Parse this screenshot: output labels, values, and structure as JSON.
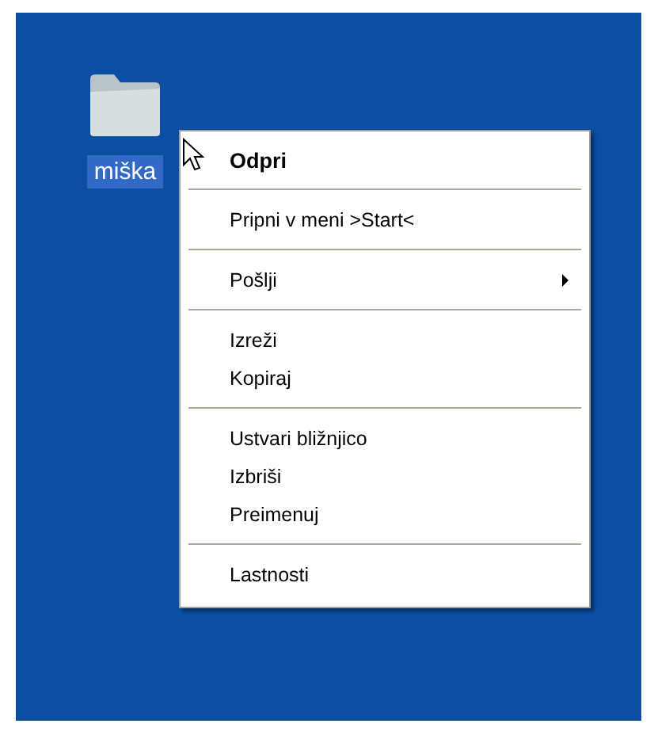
{
  "desktop_icon": {
    "label": "miška",
    "selected": true
  },
  "context_menu": {
    "groups": [
      [
        {
          "label": "Odpri",
          "default": true,
          "submenu": false
        }
      ],
      [
        {
          "label": "Pripni v meni >Start<",
          "default": false,
          "submenu": false
        }
      ],
      [
        {
          "label": "Pošlji",
          "default": false,
          "submenu": true
        }
      ],
      [
        {
          "label": "Izreži",
          "default": false,
          "submenu": false
        },
        {
          "label": "Kopiraj",
          "default": false,
          "submenu": false
        }
      ],
      [
        {
          "label": "Ustvari bližnjico",
          "default": false,
          "submenu": false
        },
        {
          "label": "Izbriši",
          "default": false,
          "submenu": false
        },
        {
          "label": "Preimenuj",
          "default": false,
          "submenu": false
        }
      ],
      [
        {
          "label": "Lastnosti",
          "default": false,
          "submenu": false
        }
      ]
    ]
  }
}
